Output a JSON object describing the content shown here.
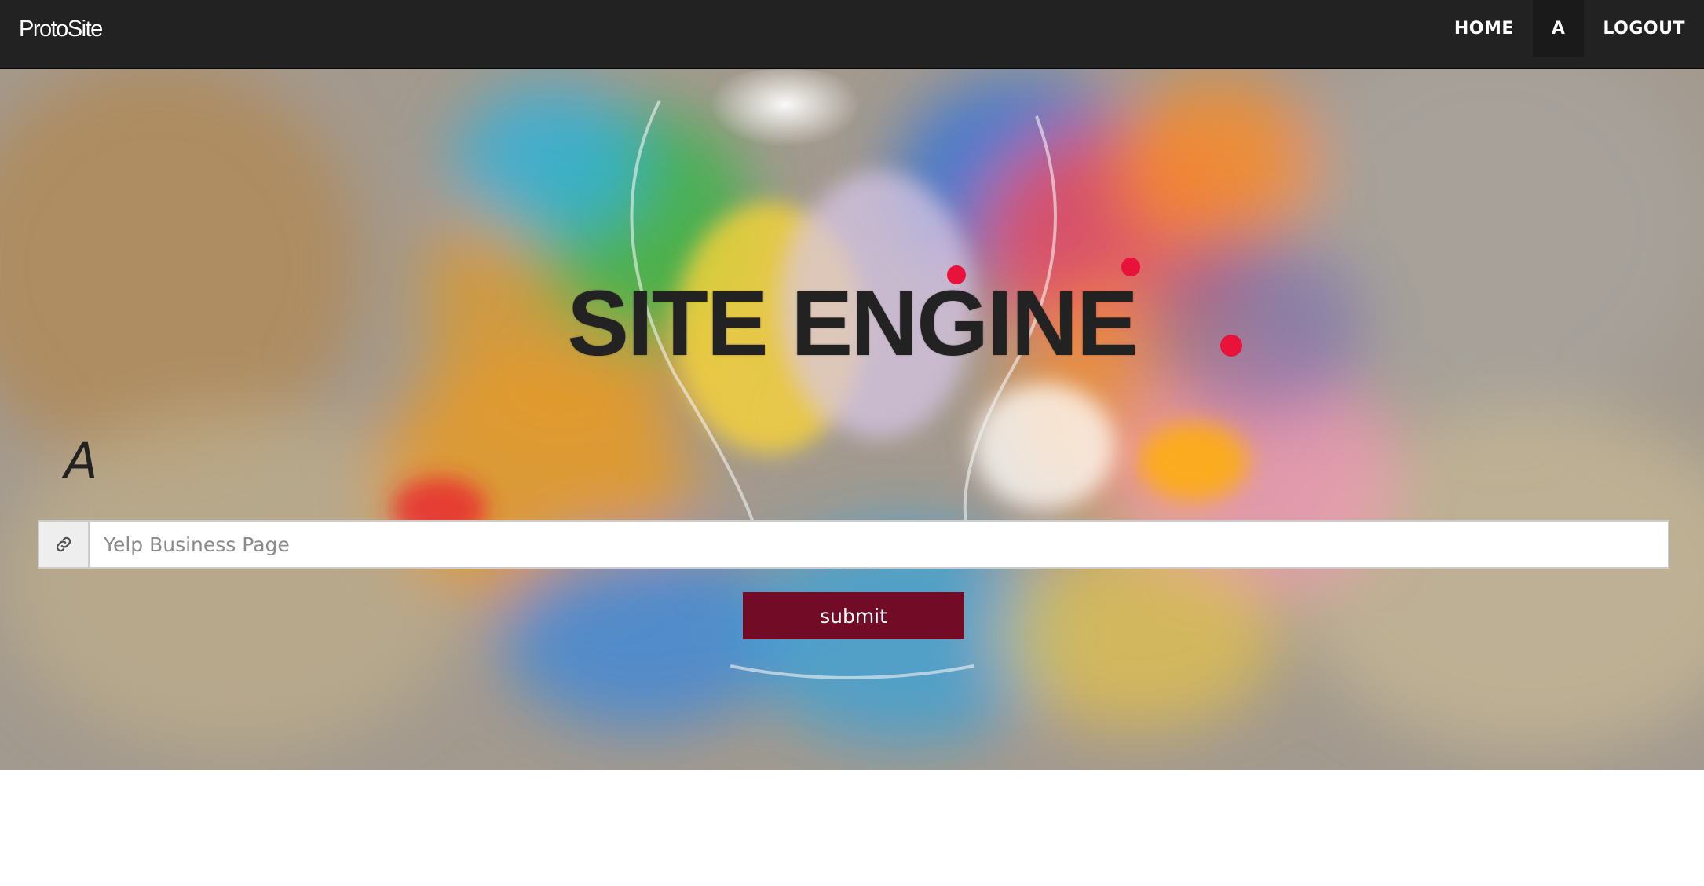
{
  "app": {
    "brand": "ProtoSite"
  },
  "nav": {
    "items": [
      {
        "label": "HOME"
      },
      {
        "label": "A"
      },
      {
        "label": "LOGOUT"
      }
    ]
  },
  "hero": {
    "title": "SITE ENGINE",
    "user_label": "A",
    "url_input": {
      "placeholder": "Yelp Business Page",
      "value": "",
      "icon": "link-icon"
    },
    "submit_label": "submit"
  },
  "colors": {
    "navbar": "#222222",
    "submit": "#720c26",
    "title": "#222222"
  }
}
